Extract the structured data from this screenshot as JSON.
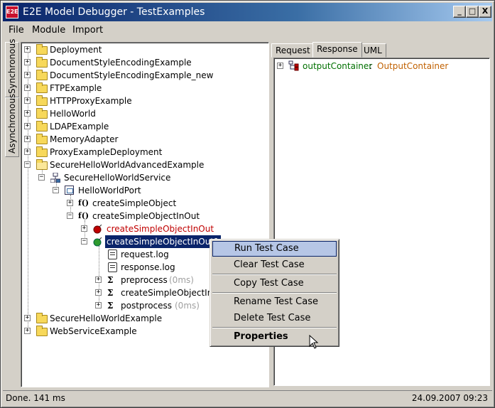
{
  "window": {
    "title": "E2E Model Debugger - TestExamples",
    "icon_text": "E2E",
    "min_btn": "_",
    "max_btn": "□",
    "close_btn": "X"
  },
  "menubar": {
    "items": [
      "File",
      "Module",
      "Import"
    ]
  },
  "side_tabs": [
    "Synchronous",
    "Asynchronous"
  ],
  "tree": {
    "items": [
      {
        "label": "Deployment"
      },
      {
        "label": "DocumentStyleEncodingExample"
      },
      {
        "label": "DocumentStyleEncodingExample_new"
      },
      {
        "label": "FTPExample"
      },
      {
        "label": "HTTPProxyExample"
      },
      {
        "label": "HelloWorld"
      },
      {
        "label": "LDAPExample"
      },
      {
        "label": "MemoryAdapter"
      },
      {
        "label": "ProxyExampleDeployment"
      },
      {
        "label": "SecureHelloWorldAdvancedExample"
      },
      {
        "label": "SecureHelloWorldService"
      },
      {
        "label": "HelloWorldPort"
      },
      {
        "label": "createSimpleObject"
      },
      {
        "label": "createSimpleObjectInOut"
      },
      {
        "label": "createSimpleObjectInOut"
      },
      {
        "label": "createSimpleObjectInOut1"
      },
      {
        "label": "request.log"
      },
      {
        "label": "response.log"
      },
      {
        "label": "preprocess",
        "suffix": "(0ms)"
      },
      {
        "label": "createSimpleObjectInOut",
        "suffix": ""
      },
      {
        "label": "postprocess",
        "suffix": "(0ms)"
      },
      {
        "label": "SecureHelloWorldExample"
      },
      {
        "label": "WebServiceExample"
      }
    ]
  },
  "right_tabs": [
    "Request",
    "Response",
    "UML"
  ],
  "response": {
    "name": "outputContainer",
    "separator": " : ",
    "type": "OutputContainer"
  },
  "context_menu": {
    "items": [
      "Run Test Case",
      "Clear Test Case",
      "Copy Test Case",
      "Rename Test Case",
      "Delete Test Case",
      "Properties"
    ]
  },
  "status": {
    "left": "Done. 141 ms",
    "right": "24.09.2007 09:23"
  },
  "colors": {
    "title_bar": "#0a246a",
    "selected": "#0a246a",
    "error_node": "#c00000",
    "response_name": "#007000",
    "response_type": "#c06000"
  }
}
